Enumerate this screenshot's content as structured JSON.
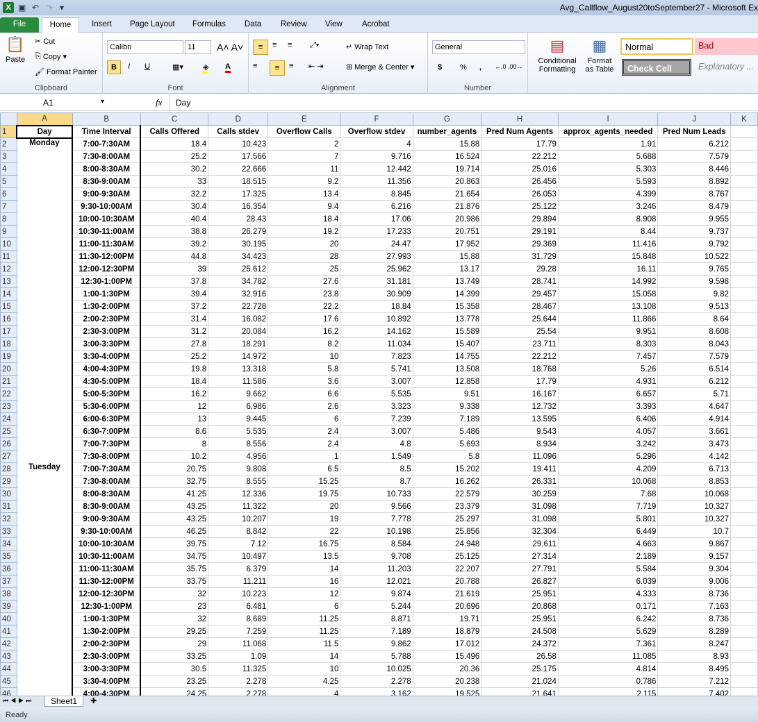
{
  "window": {
    "title": "Avg_Callflow_August20toSeptember27 - Microsoft Ex"
  },
  "ribbon_tabs": [
    "File",
    "Home",
    "Insert",
    "Page Layout",
    "Formulas",
    "Data",
    "Review",
    "View",
    "Acrobat"
  ],
  "clipboard": {
    "paste": "Paste",
    "cut": "Cut",
    "copy": "Copy",
    "format_painter": "Format Painter",
    "label": "Clipboard"
  },
  "font": {
    "name": "Calibri",
    "size": "11",
    "bold": "B",
    "italic": "I",
    "underline": "U",
    "label": "Font"
  },
  "alignment": {
    "wrap": "Wrap Text",
    "merge": "Merge & Center",
    "label": "Alignment"
  },
  "number": {
    "format": "General",
    "currency": "$",
    "percent": "%",
    "comma": ",",
    "label": "Number"
  },
  "styles": {
    "conditional": "Conditional Formatting",
    "format_table": "Format as Table",
    "normal": "Normal",
    "bad": "Bad",
    "check": "Check Cell",
    "explanatory": "Explanatory ..."
  },
  "formula_bar": {
    "name_box": "A1",
    "fx": "fx",
    "content": "Day"
  },
  "colors": {
    "bad_bg": "#ffc7ce",
    "bad_text": "#9c0006",
    "check_bg": "#a5a5a5",
    "file_tab": "#2a8a3e"
  },
  "grid": {
    "columns": [
      "A",
      "B",
      "C",
      "D",
      "E",
      "F",
      "G",
      "H",
      "I",
      "J",
      "K"
    ],
    "headers": [
      "Day",
      "Time Interval",
      "Calls Offered",
      "Calls stdev",
      "Overflow Calls",
      "Overflow stdev",
      "number_agents",
      "Pred Num Agents",
      "approx_agents_needed",
      "Pred Num Leads"
    ],
    "rows": [
      [
        "Monday",
        "7:00-7:30AM",
        "18.4",
        "10.423",
        "2",
        "4",
        "15.88",
        "17.79",
        "1.91",
        "6.212"
      ],
      [
        "",
        "7:30-8:00AM",
        "25.2",
        "17.566",
        "7",
        "9.716",
        "16.524",
        "22.212",
        "5.688",
        "7.579"
      ],
      [
        "",
        "8:00-8:30AM",
        "30.2",
        "22.666",
        "11",
        "12.442",
        "19.714",
        "25.016",
        "5.303",
        "8.446"
      ],
      [
        "",
        "8:30-9:00AM",
        "33",
        "18.515",
        "9.2",
        "11.356",
        "20.863",
        "26.456",
        "5.593",
        "8.892"
      ],
      [
        "",
        "9:00-9:30AM",
        "32.2",
        "17.325",
        "13.4",
        "8.845",
        "21.654",
        "26.053",
        "4.399",
        "8.767"
      ],
      [
        "",
        "9:30-10:00AM",
        "30.4",
        "16.354",
        "9.4",
        "6.216",
        "21.876",
        "25.122",
        "3.246",
        "8.479"
      ],
      [
        "",
        "10:00-10:30AM",
        "40.4",
        "28.43",
        "18.4",
        "17.06",
        "20.986",
        "29.894",
        "8.908",
        "9.955"
      ],
      [
        "",
        "10:30-11:00AM",
        "38.8",
        "26.279",
        "19.2",
        "17.233",
        "20.751",
        "29.191",
        "8.44",
        "9.737"
      ],
      [
        "",
        "11:00-11:30AM",
        "39.2",
        "30.195",
        "20",
        "24.47",
        "17.952",
        "29.369",
        "11.416",
        "9.792"
      ],
      [
        "",
        "11:30-12:00PM",
        "44.8",
        "34.423",
        "28",
        "27.993",
        "15.88",
        "31.729",
        "15.848",
        "10.522"
      ],
      [
        "",
        "12:00-12:30PM",
        "39",
        "25.612",
        "25",
        "25.962",
        "13.17",
        "29.28",
        "16.11",
        "9.765"
      ],
      [
        "",
        "12:30-1:00PM",
        "37.8",
        "34.782",
        "27.6",
        "31.181",
        "13.749",
        "28.741",
        "14.992",
        "9.598"
      ],
      [
        "",
        "1:00-1:30PM",
        "39.4",
        "32.916",
        "23.8",
        "30.909",
        "14.399",
        "29.457",
        "15.058",
        "9.82"
      ],
      [
        "",
        "1:30-2:00PM",
        "37.2",
        "22.728",
        "22.2",
        "18.84",
        "15.358",
        "28.467",
        "13.108",
        "9.513"
      ],
      [
        "",
        "2:00-2:30PM",
        "31.4",
        "16.082",
        "17.6",
        "10.892",
        "13.778",
        "25.644",
        "11.866",
        "8.64"
      ],
      [
        "",
        "2:30-3:00PM",
        "31.2",
        "20.084",
        "16.2",
        "14.162",
        "15.589",
        "25.54",
        "9.951",
        "8.608"
      ],
      [
        "",
        "3:00-3:30PM",
        "27.8",
        "18.291",
        "8.2",
        "11.034",
        "15.407",
        "23.711",
        "8.303",
        "8.043"
      ],
      [
        "",
        "3:30-4:00PM",
        "25.2",
        "14.972",
        "10",
        "7.823",
        "14.755",
        "22.212",
        "7.457",
        "7.579"
      ],
      [
        "",
        "4:00-4:30PM",
        "19.8",
        "13.318",
        "5.8",
        "5.741",
        "13.508",
        "18.768",
        "5.26",
        "6.514"
      ],
      [
        "",
        "4:30-5:00PM",
        "18.4",
        "11.586",
        "3.6",
        "3.007",
        "12.858",
        "17.79",
        "4.931",
        "6.212"
      ],
      [
        "",
        "5:00-5:30PM",
        "16.2",
        "9.662",
        "6.6",
        "5.535",
        "9.51",
        "16.167",
        "6.657",
        "5.71"
      ],
      [
        "",
        "5:30-6:00PM",
        "12",
        "6.986",
        "2.6",
        "3.323",
        "9.338",
        "12.732",
        "3.393",
        "4.647"
      ],
      [
        "",
        "6:00-6:30PM",
        "13",
        "9.445",
        "6",
        "7.239",
        "7.189",
        "13.595",
        "6.406",
        "4.914"
      ],
      [
        "",
        "6:30-7:00PM",
        "8.6",
        "5.535",
        "2.4",
        "3.007",
        "5.486",
        "9.543",
        "4.057",
        "3.661"
      ],
      [
        "",
        "7:00-7:30PM",
        "8",
        "8.556",
        "2.4",
        "4.8",
        "5.693",
        "8.934",
        "3.242",
        "3.473"
      ],
      [
        "",
        "7:30-8:00PM",
        "10.2",
        "4.956",
        "1",
        "1.549",
        "5.8",
        "11.096",
        "5.296",
        "4.142"
      ],
      [
        "Tuesday",
        "7:00-7:30AM",
        "20.75",
        "9.808",
        "6.5",
        "8.5",
        "15.202",
        "19.411",
        "4.209",
        "6.713"
      ],
      [
        "",
        "7:30-8:00AM",
        "32.75",
        "8.555",
        "15.25",
        "8.7",
        "16.262",
        "26.331",
        "10.068",
        "8.853"
      ],
      [
        "",
        "8:00-8:30AM",
        "41.25",
        "12.336",
        "19.75",
        "10.733",
        "22.579",
        "30.259",
        "7.68",
        "10.068"
      ],
      [
        "",
        "8:30-9:00AM",
        "43.25",
        "11.322",
        "20",
        "9.566",
        "23.379",
        "31.098",
        "7.719",
        "10.327"
      ],
      [
        "",
        "9:00-9:30AM",
        "43.25",
        "10.207",
        "19",
        "7.778",
        "25.297",
        "31.098",
        "5.801",
        "10.327"
      ],
      [
        "",
        "9:30-10:00AM",
        "46.25",
        "8.842",
        "22",
        "10.198",
        "25.856",
        "32.304",
        "6.449",
        "10.7"
      ],
      [
        "",
        "10:00-10:30AM",
        "39.75",
        "7.12",
        "16.75",
        "8.584",
        "24.948",
        "29.611",
        "4.663",
        "9.867"
      ],
      [
        "",
        "10:30-11:00AM",
        "34.75",
        "10.497",
        "13.5",
        "9.708",
        "25.125",
        "27.314",
        "2.189",
        "9.157"
      ],
      [
        "",
        "11:00-11:30AM",
        "35.75",
        "6.379",
        "14",
        "11.203",
        "22.207",
        "27.791",
        "5.584",
        "9.304"
      ],
      [
        "",
        "11:30-12:00PM",
        "33.75",
        "11.211",
        "16",
        "12.021",
        "20.788",
        "26.827",
        "6.039",
        "9.006"
      ],
      [
        "",
        "12:00-12:30PM",
        "32",
        "10.223",
        "12",
        "9.874",
        "21.619",
        "25.951",
        "4.333",
        "8.736"
      ],
      [
        "",
        "12:30-1:00PM",
        "23",
        "6.481",
        "6",
        "5.244",
        "20.696",
        "20.868",
        "0.171",
        "7.163"
      ],
      [
        "",
        "1:00-1:30PM",
        "32",
        "8.689",
        "11.25",
        "8.871",
        "19.71",
        "25.951",
        "6.242",
        "8.736"
      ],
      [
        "",
        "1:30-2:00PM",
        "29.25",
        "7.259",
        "11.25",
        "7.189",
        "18.879",
        "24.508",
        "5.629",
        "8.289"
      ],
      [
        "",
        "2:00-2:30PM",
        "29",
        "11.068",
        "11.5",
        "9.862",
        "17.012",
        "24.372",
        "7.361",
        "8.247"
      ],
      [
        "",
        "2:30-3:00PM",
        "33.25",
        "1.09",
        "14",
        "5.788",
        "15.496",
        "26.58",
        "11.085",
        "8.93"
      ],
      [
        "",
        "3:00-3:30PM",
        "30.5",
        "11.325",
        "10",
        "10.025",
        "20.36",
        "25.175",
        "4.814",
        "8.495"
      ],
      [
        "",
        "3:30-4:00PM",
        "23.25",
        "2.278",
        "4.25",
        "2.278",
        "20.238",
        "21.024",
        "0.786",
        "7.212"
      ],
      [
        "",
        "4:00-4:30PM",
        "24.25",
        "2.278",
        "4",
        "3.162",
        "19.525",
        "21.641",
        "2.115",
        "7.402"
      ]
    ]
  },
  "sheets": [
    "Sheet1"
  ],
  "status": "Ready"
}
